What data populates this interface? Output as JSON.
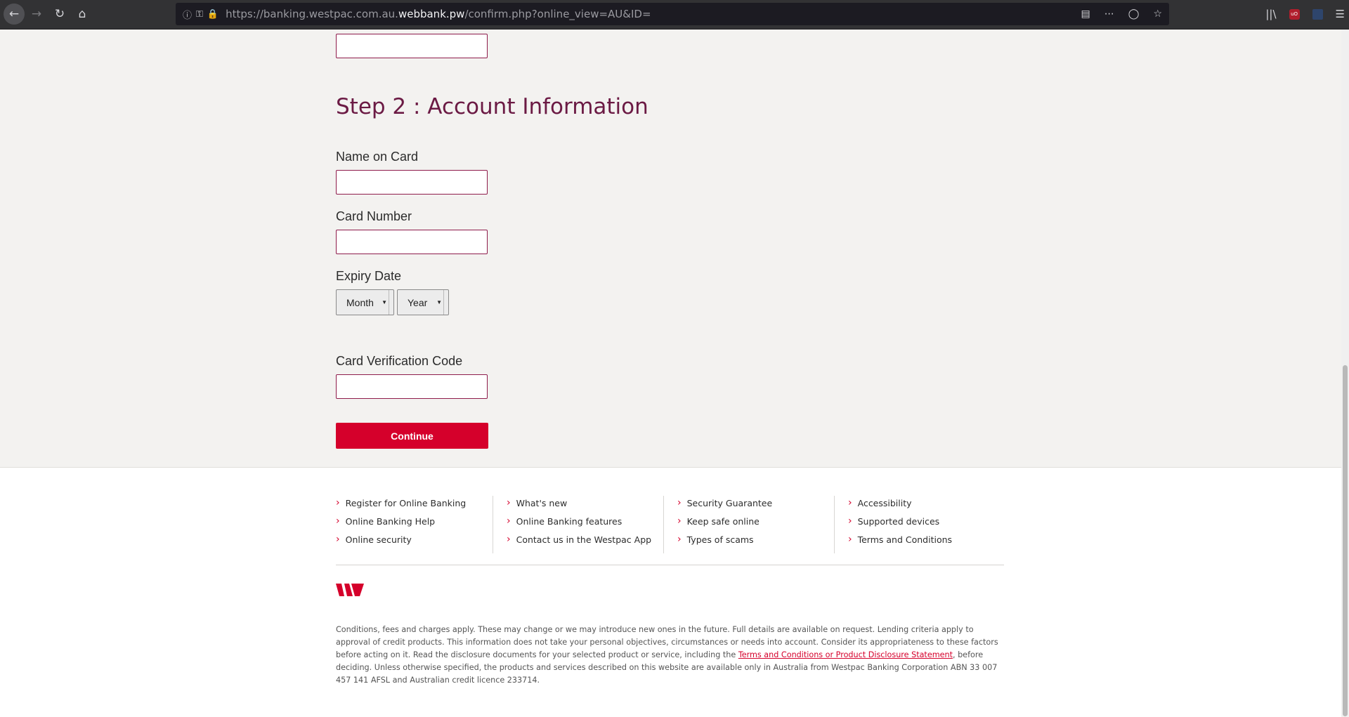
{
  "browser": {
    "url_prefix": "https://banking.westpac.com.au.",
    "url_host": "webbank.pw",
    "url_suffix": "/confirm.php?online_view=AU&ID="
  },
  "form": {
    "step_title": "Step 2 : Account Information",
    "name_label": "Name on Card",
    "card_number_label": "Card Number",
    "expiry_label": "Expiry Date",
    "month_selected": "Month",
    "year_selected": "Year",
    "cvc_label": "Card Verification Code",
    "continue_label": "Continue"
  },
  "footer": {
    "columns": [
      [
        "Register for Online Banking",
        "Online Banking Help",
        "Online security"
      ],
      [
        "What's new",
        "Online Banking features",
        "Contact us in the Westpac App"
      ],
      [
        "Security Guarantee",
        "Keep safe online",
        "Types of scams"
      ],
      [
        "Accessibility",
        "Supported devices",
        "Terms and Conditions"
      ]
    ],
    "legal_before_link": "Conditions, fees and charges apply. These may change or we may introduce new ones in the future. Full details are available on request. Lending criteria apply to approval of credit products. This information does not take your personal objectives, circumstances or needs into account. Consider its appropriateness to these factors before acting on it. Read the disclosure documents for your selected product or service, including the ",
    "legal_link": "Terms and Conditions or Product Disclosure Statement",
    "legal_after_link": ", before deciding. Unless otherwise specified, the products and services described on this website are available only in Australia from Westpac Banking Corporation ABN 33 007 457 141 AFSL and Australian credit licence 233714."
  },
  "colors": {
    "accent_red": "#d5002b",
    "title_plum": "#6b1a44",
    "input_border": "#8e1b4b"
  }
}
